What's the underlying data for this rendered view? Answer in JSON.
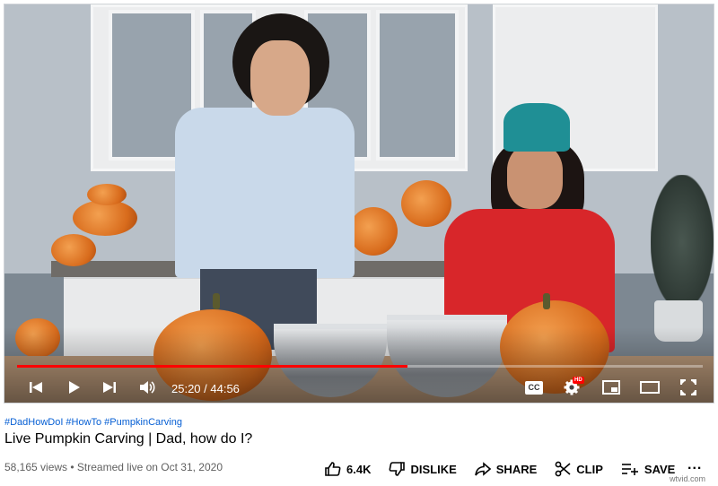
{
  "player": {
    "time": "25:20 / 44:56",
    "progress_fraction": 0.57,
    "hd_badge": "HD",
    "cc_label": "CC",
    "icons": [
      "prev-icon",
      "play-icon",
      "next-icon",
      "volume-icon",
      "cc-icon",
      "settings-icon",
      "miniplayer-icon",
      "theater-icon",
      "fullscreen-icon"
    ],
    "accent": "#ff0000"
  },
  "video": {
    "hashtags": [
      "#DadHowDoI",
      "#HowTo",
      "#PumpkinCarving"
    ],
    "title": "Live Pumpkin Carving | Dad, how do I?",
    "meta": "58,165 views • Streamed live on Oct 31, 2020"
  },
  "actions": {
    "like": "6.4K",
    "dislike": "DISLIKE",
    "share": "SHARE",
    "clip": "CLIP",
    "save": "SAVE",
    "more": "..."
  },
  "watermark": "wtvid.com"
}
